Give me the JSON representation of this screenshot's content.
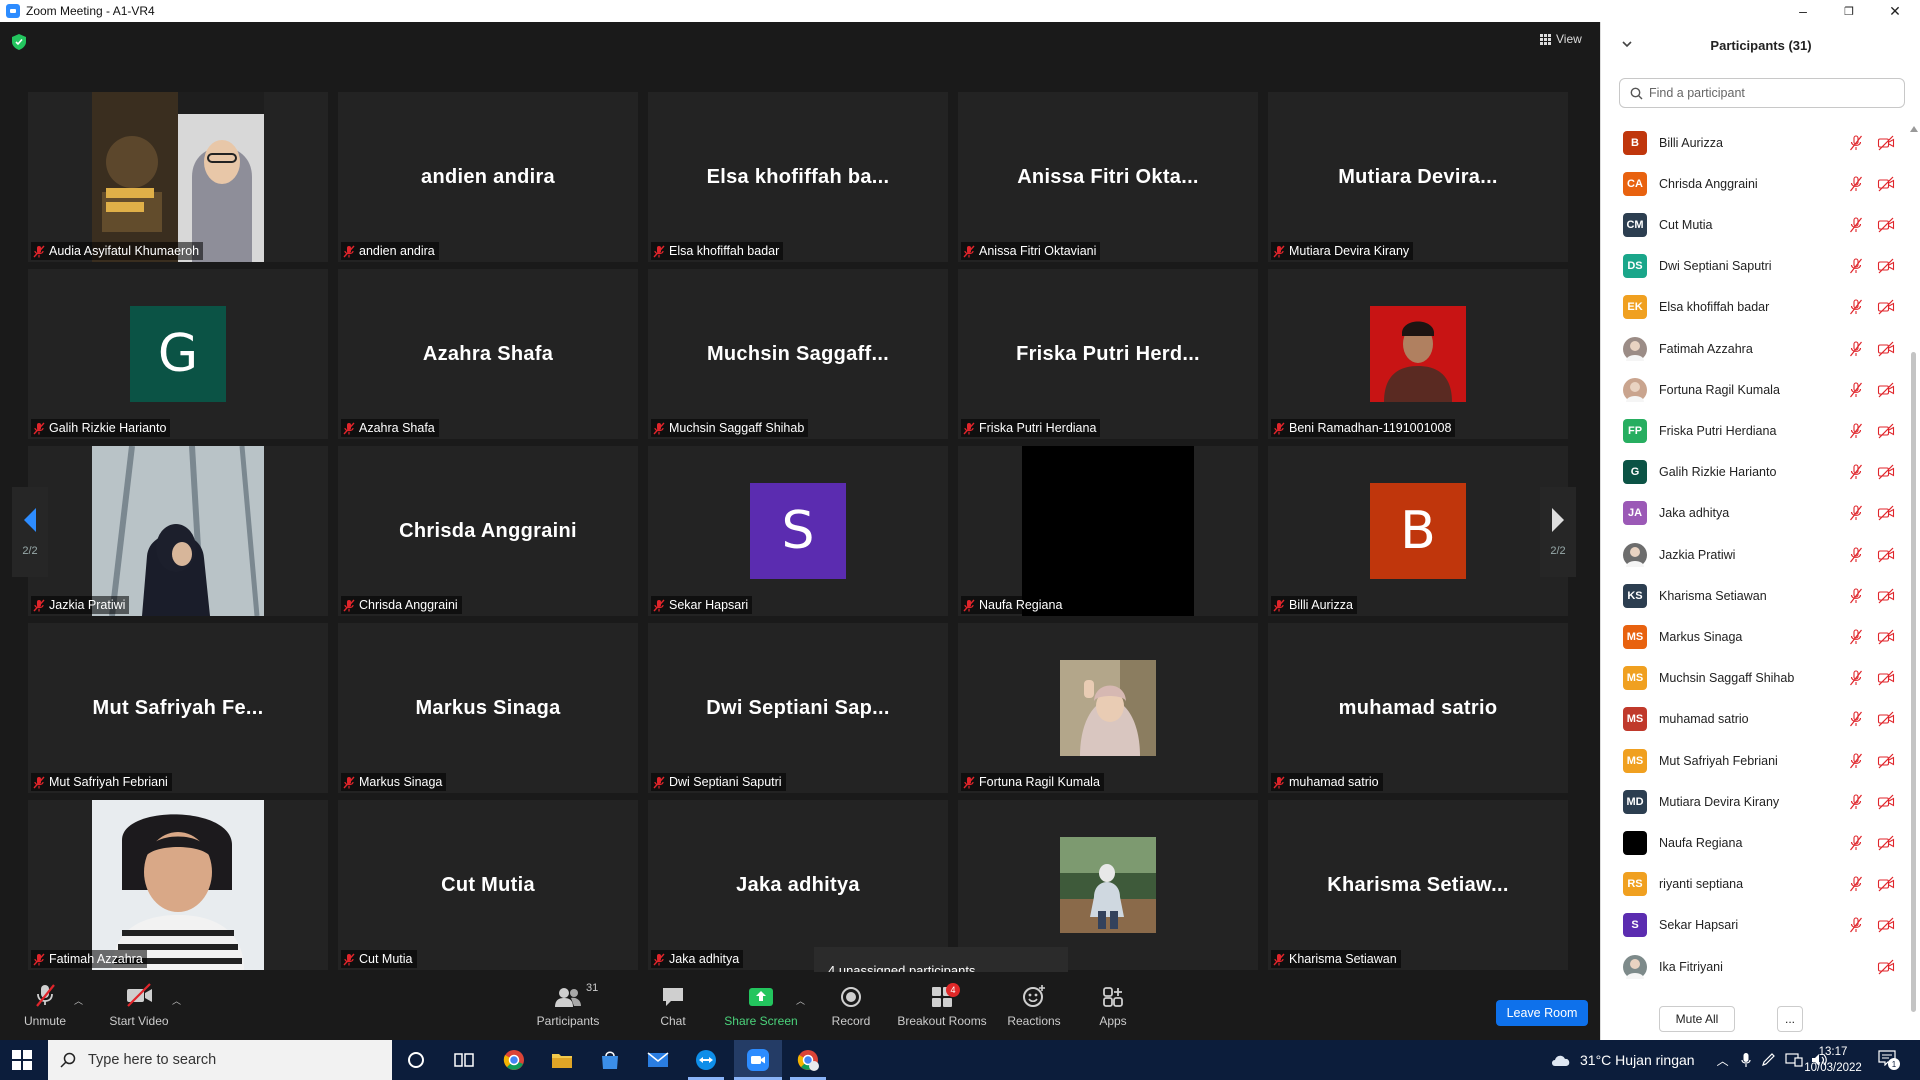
{
  "window": {
    "title": "Zoom Meeting - A1-VR4",
    "controls": [
      "–",
      "❐",
      "✕"
    ]
  },
  "meeting": {
    "view_label": "View",
    "page_indicator": "2/2",
    "unassigned_popup": "4 unassigned participants",
    "tiles": [
      {
        "name": "Audia Asyifatul Khumaeroh",
        "kind": "photo",
        "photo": "poster"
      },
      {
        "name": "andien andira",
        "kind": "text",
        "display": "andien andira"
      },
      {
        "name": "Elsa khofiffah badar",
        "kind": "text",
        "display": "Elsa khofiffah ba..."
      },
      {
        "name": "Anissa Fitri Oktaviani",
        "kind": "text",
        "display": "Anissa Fitri Okta..."
      },
      {
        "name": "Mutiara Devira Kirany",
        "kind": "text",
        "display": "Mutiara Devira..."
      },
      {
        "name": "Galih Rizkie Harianto",
        "kind": "avatar",
        "letter": "G",
        "color": "#0b5345"
      },
      {
        "name": "Azahra Shafa",
        "kind": "text",
        "display": "Azahra Shafa"
      },
      {
        "name": "Muchsin Saggaff Shihab",
        "kind": "text",
        "display": "Muchsin  Saggaff..."
      },
      {
        "name": "Friska Putri Herdiana",
        "kind": "text",
        "display": "Friska Putri Herd..."
      },
      {
        "name": "Beni Ramadhan-1191001008",
        "kind": "small-photo",
        "photo": "red-portrait"
      },
      {
        "name": "Jazkia Pratiwi",
        "kind": "photo",
        "photo": "window-hijab"
      },
      {
        "name": "Chrisda Anggraini",
        "kind": "text",
        "display": "Chrisda Anggraini"
      },
      {
        "name": "Sekar Hapsari",
        "kind": "avatar",
        "letter": "S",
        "color": "#5b2cb0"
      },
      {
        "name": "Naufa Regiana",
        "kind": "black",
        "photo": "black"
      },
      {
        "name": "Billi Aurizza",
        "kind": "avatar",
        "letter": "B",
        "color": "#c0360c"
      },
      {
        "name": "Mut Safriyah Febriani",
        "kind": "text",
        "display": "Mut Safriyah Fe..."
      },
      {
        "name": "Markus Sinaga",
        "kind": "text",
        "display": "Markus Sinaga"
      },
      {
        "name": "Dwi Septiani Saputri",
        "kind": "text",
        "display": "Dwi Septiani Sap..."
      },
      {
        "name": "Fortuna Ragil Kumala",
        "kind": "small-photo",
        "photo": "selfie-hijab"
      },
      {
        "name": "muhamad satrio",
        "kind": "text",
        "display": "muhamad satrio"
      },
      {
        "name": "Fatimah Azzahra",
        "kind": "photo",
        "photo": "striped-shirt"
      },
      {
        "name": "Cut Mutia",
        "kind": "text",
        "display": "Cut Mutia"
      },
      {
        "name": "Jaka adhitya",
        "kind": "text",
        "display": "Jaka adhitya"
      },
      {
        "name": "",
        "kind": "small-photo",
        "photo": "garden-sitting"
      },
      {
        "name": "Kharisma Setiawan",
        "kind": "text",
        "display": "Kharisma  Setiaw..."
      }
    ]
  },
  "toolbar": {
    "unmute": "Unmute",
    "start_video": "Start Video",
    "participants": "Participants",
    "participants_count": "31",
    "chat": "Chat",
    "share_screen": "Share Screen",
    "record": "Record",
    "breakout_rooms": "Breakout Rooms",
    "breakout_badge": "4",
    "reactions": "Reactions",
    "apps": "Apps",
    "leave_room": "Leave Room"
  },
  "panel": {
    "title": "Participants (31)",
    "search_placeholder": "Find a participant",
    "mute_all": "Mute All",
    "more": "...",
    "participants": [
      {
        "initials": "B",
        "name": "Billi Aurizza",
        "color": "#c0360c",
        "mic": true
      },
      {
        "initials": "CA",
        "name": "Chrisda Anggraini",
        "color": "#e8620f",
        "mic": true
      },
      {
        "initials": "CM",
        "name": "Cut Mutia",
        "color": "#2c3e50",
        "mic": true
      },
      {
        "initials": "DS",
        "name": "Dwi Septiani Saputri",
        "color": "#1aa68a",
        "mic": true
      },
      {
        "initials": "EK",
        "name": "Elsa khofiffah badar",
        "color": "#f0a020",
        "mic": true
      },
      {
        "initials": "",
        "name": "Fatimah Azzahra",
        "color": "#9b8c86",
        "mic": true
      },
      {
        "initials": "",
        "name": "Fortuna Ragil Kumala",
        "color": "#c9a48e",
        "mic": true
      },
      {
        "initials": "FP",
        "name": "Friska Putri Herdiana",
        "color": "#27ae60",
        "mic": true
      },
      {
        "initials": "G",
        "name": "Galih Rizkie Harianto",
        "color": "#0b5345",
        "mic": true
      },
      {
        "initials": "JA",
        "name": "Jaka adhitya",
        "color": "#9b59b6",
        "mic": true
      },
      {
        "initials": "",
        "name": "Jazkia Pratiwi",
        "color": "#6d6d6d",
        "mic": true
      },
      {
        "initials": "KS",
        "name": "Kharisma Setiawan",
        "color": "#2c3e50",
        "mic": true
      },
      {
        "initials": "MS",
        "name": "Markus Sinaga",
        "color": "#e8620f",
        "mic": true
      },
      {
        "initials": "MS",
        "name": "Muchsin Saggaff Shihab",
        "color": "#f0a020",
        "mic": true
      },
      {
        "initials": "MS",
        "name": "muhamad satrio",
        "color": "#c0392b",
        "mic": true
      },
      {
        "initials": "MS",
        "name": "Mut Safriyah Febriani",
        "color": "#f0a020",
        "mic": true
      },
      {
        "initials": "MD",
        "name": "Mutiara Devira Kirany",
        "color": "#2c3e50",
        "mic": true
      },
      {
        "initials": "",
        "name": "Naufa Regiana",
        "color": "#000000",
        "mic": true
      },
      {
        "initials": "RS",
        "name": "riyanti septiana",
        "color": "#f0a020",
        "mic": true
      },
      {
        "initials": "S",
        "name": "Sekar Hapsari",
        "color": "#5b2cb0",
        "mic": true
      },
      {
        "initials": "",
        "name": "Ika Fitriyani",
        "color": "#7d8a8a",
        "mic": false
      }
    ]
  },
  "taskbar": {
    "search_placeholder": "Type here to search",
    "weather": "31°C  Hujan ringan",
    "time": "13:17",
    "date": "10/03/2022",
    "notification_count": "1"
  }
}
